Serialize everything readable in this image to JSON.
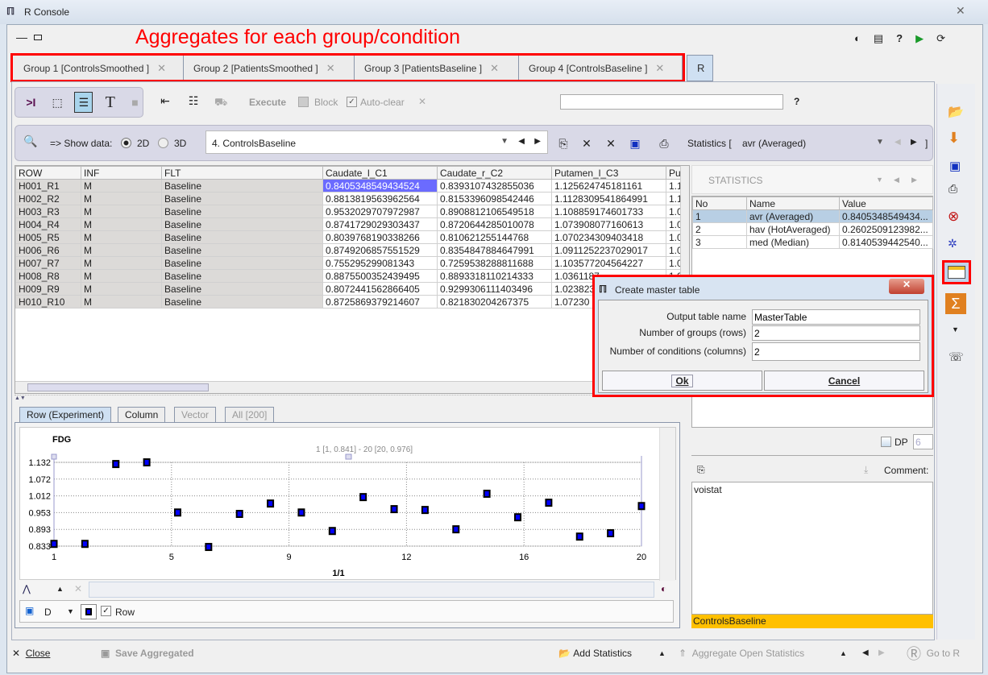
{
  "window": {
    "title": "R Console"
  },
  "annotation": "Aggregates for each group/condition",
  "tabs": [
    {
      "label": "Group 1 [ControlsSmoothed ]"
    },
    {
      "label": "Group 2 [PatientsSmoothed ]"
    },
    {
      "label": "Group 3 [PatientsBaseline ]"
    },
    {
      "label": "Group 4 [ControlsBaseline ]"
    },
    {
      "label": "R"
    }
  ],
  "toolbar": {
    "execute": "Execute",
    "block": "Block",
    "auto_clear": "Auto-clear",
    "auto_clear_checked": true,
    "help": "?",
    "command_value": ""
  },
  "showdata": {
    "label": "=> Show data:",
    "opt2d": "2D",
    "opt3d": "3D",
    "selected": "2D",
    "dataset": "4. ControlsBaseline",
    "stats_label": "Statistics [",
    "stats_value": "avr (Averaged)",
    "stats_close": "]"
  },
  "table": {
    "columns": [
      "ROW",
      "INF",
      "FLT",
      "Caudate_l_C1",
      "Caudate_r_C2",
      "Putamen_l_C3",
      "Pu"
    ],
    "rows": [
      [
        "H001_R1",
        "M",
        "Baseline",
        "0.8405348549434524",
        "0.8393107432855036",
        "1.125624745181161",
        "1.1"
      ],
      [
        "H002_R2",
        "M",
        "Baseline",
        "0.8813819563962564",
        "0.8153396098542446",
        "1.1128309541864991",
        "1.1"
      ],
      [
        "H003_R3",
        "M",
        "Baseline",
        "0.9532029707972987",
        "0.8908812106549518",
        "1.108859174601733",
        "1.0"
      ],
      [
        "H004_R4",
        "M",
        "Baseline",
        "0.8741729029303437",
        "0.8720644285010078",
        "1.073908077160613",
        "1.0"
      ],
      [
        "H005_R5",
        "M",
        "Baseline",
        "0.8039768190338266",
        "0.810621255144768",
        "1.070234309403418",
        "1.0"
      ],
      [
        "H006_R6",
        "M",
        "Baseline",
        "0.8749206857551529",
        "0.8354847884647991",
        "1.0911252237029017",
        "1.0"
      ],
      [
        "H007_R7",
        "M",
        "Baseline",
        "0.755295299081343",
        "0.7259538288811688",
        "1.103577204564227",
        "1.0"
      ],
      [
        "H008_R8",
        "M",
        "Baseline",
        "0.8875500352439495",
        "0.8893318110214333",
        "1.0361187",
        "1.0"
      ],
      [
        "H009_R9",
        "M",
        "Baseline",
        "0.8072441562866405",
        "0.9299306111403496",
        "1.023823",
        "1.0"
      ],
      [
        "H010_R10",
        "M",
        "Baseline",
        "0.8725869379214607",
        "0.821830204267375",
        "1.07230",
        "1.0"
      ]
    ]
  },
  "chart_tabs": [
    {
      "label": "Row (Experiment)"
    },
    {
      "label": "Column"
    },
    {
      "label": "Vector"
    },
    {
      "label": "All [200]"
    }
  ],
  "chart_data": {
    "type": "scatter",
    "title": "FDG",
    "subtitle": "1 [1, 0.841] - 20 [20, 0.976]",
    "xlabel": "1/1",
    "ylabel": "",
    "x": [
      1,
      2,
      3,
      4,
      5,
      6,
      7,
      8,
      9,
      10,
      11,
      12,
      13,
      14,
      15,
      16,
      17,
      18,
      19,
      20
    ],
    "y": [
      0.841,
      0.841,
      1.126,
      1.132,
      0.953,
      0.83,
      0.948,
      0.985,
      0.953,
      0.887,
      1.008,
      0.965,
      0.962,
      0.893,
      1.02,
      0.936,
      0.988,
      0.867,
      0.879,
      0.976
    ],
    "xlim": [
      1,
      20
    ],
    "ylim": [
      0.833,
      1.132
    ],
    "xticks": [
      "1",
      "5",
      "9",
      "12",
      "16",
      "20"
    ],
    "yticks": [
      "1.132",
      "1.072",
      "1.012",
      "0.953",
      "0.893",
      "0.833"
    ],
    "grid": true,
    "marker_color": "#0000ff"
  },
  "legend": {
    "symbol": "D",
    "row_label": "Row",
    "row_checked": true
  },
  "stats": {
    "header": "STATISTICS",
    "columns": [
      "No",
      "Name",
      "Value"
    ],
    "rows": [
      [
        "1",
        "avr (Averaged)",
        "0.8405348549434..."
      ],
      [
        "2",
        "hav (HotAveraged)",
        "0.2602509123982..."
      ],
      [
        "3",
        "med (Median)",
        "0.8140539442540..."
      ]
    ],
    "dp_label": "DP",
    "dp_value": "6",
    "comment_label": "Comment:",
    "comment": "voistat",
    "selected_group": "ControlsBaseline"
  },
  "dialog": {
    "title": "Create master table",
    "fields": [
      {
        "label": "Output table name",
        "value": "MasterTable"
      },
      {
        "label": "Number of groups (rows)",
        "value": "2"
      },
      {
        "label": "Number of conditions (columns)",
        "value": "2"
      }
    ],
    "ok": "Ok",
    "cancel": "Cancel"
  },
  "bottom": {
    "close": "Close",
    "save": "Save Aggregated",
    "add_stats": "Add Statistics",
    "aggregate": "Aggregate Open Statistics",
    "goto": "Go to R"
  }
}
